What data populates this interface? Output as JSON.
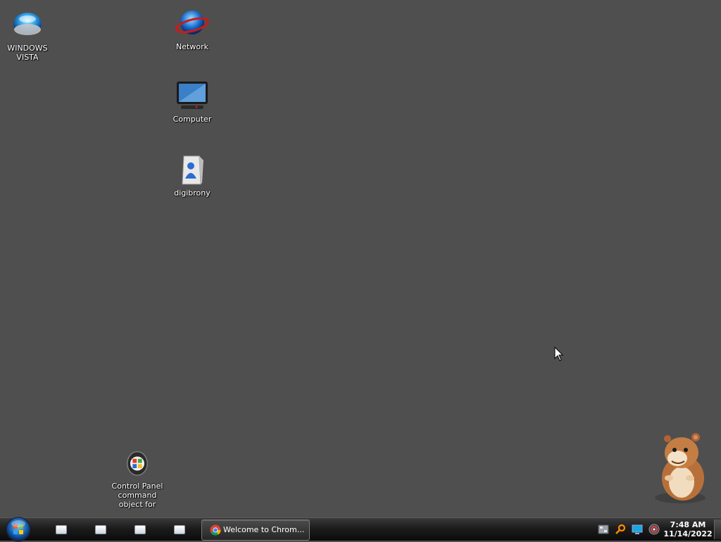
{
  "desktop": {
    "icons": [
      {
        "label": "WINDOWS\nVISTA",
        "icon": "vista-orb-icon"
      },
      {
        "label": "Network",
        "icon": "network-globe-icon"
      },
      {
        "label": "Computer",
        "icon": "computer-monitor-icon"
      },
      {
        "label": "digibrony",
        "icon": "user-folder-icon"
      },
      {
        "label": "Control Panel command object for Start menu",
        "icon": "control-panel-icon"
      }
    ],
    "mascot": "hamster-mascot",
    "background_color": "#4f4f4f"
  },
  "taskbar": {
    "start_button": "windows-start-orb",
    "quick_launch": [
      "blank-window-icon",
      "blank-window-icon",
      "blank-window-icon",
      "blank-window-icon"
    ],
    "open_window": {
      "label": "Welcome to Chrom...",
      "icon": "chrome-icon"
    },
    "tray_icons": [
      "network-tray-icon",
      "search-tray-icon",
      "display-tray-icon",
      "media-tray-icon"
    ],
    "clock": {
      "time": "7:48 AM",
      "date": "11/14/2022"
    }
  }
}
